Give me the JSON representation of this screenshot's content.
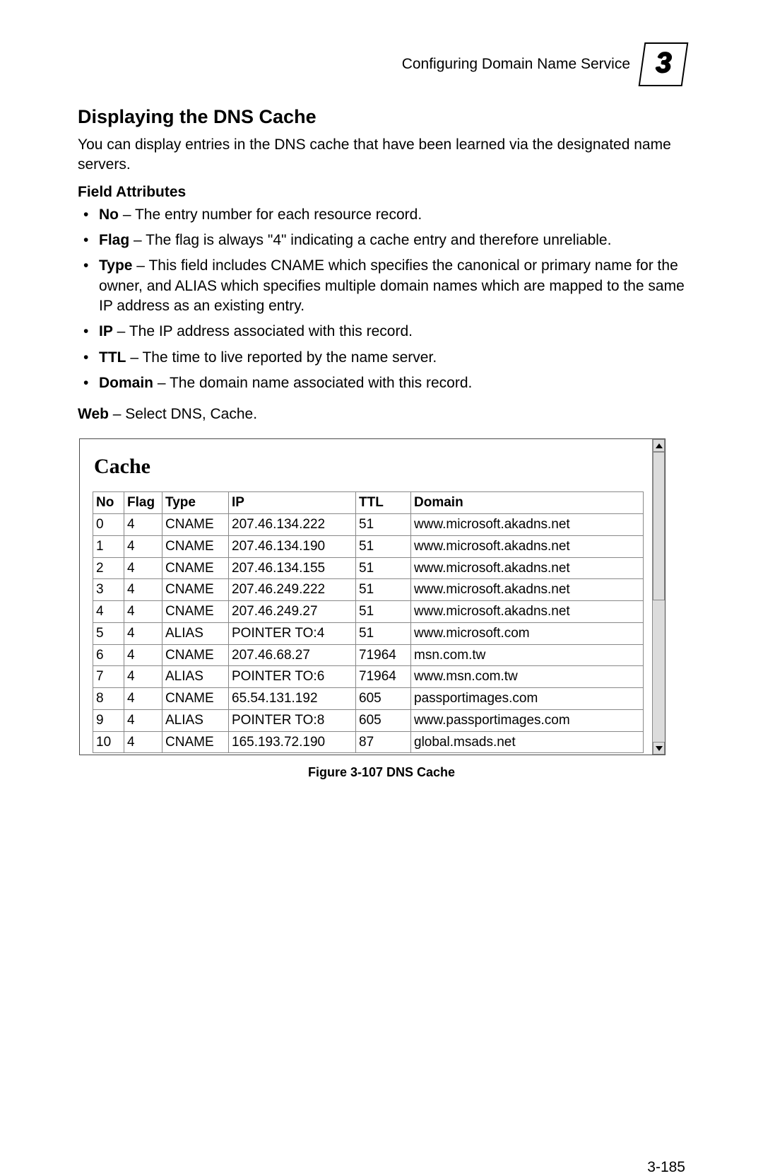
{
  "header": {
    "breadcrumb": "Configuring Domain Name Service",
    "chapter": "3"
  },
  "section": {
    "title": "Displaying the DNS Cache",
    "intro": "You can display entries in the DNS cache that have been learned via the designated name servers.",
    "field_attributes_heading": "Field Attributes",
    "attributes": [
      {
        "term": "No",
        "desc": " – The entry number for each resource record."
      },
      {
        "term": "Flag",
        "desc": " – The flag is always \"4\" indicating a cache entry and therefore unreliable."
      },
      {
        "term": "Type",
        "desc": " – This field includes CNAME which specifies the canonical or primary name for the owner, and ALIAS which specifies multiple domain names which are mapped to the same IP address as an existing entry."
      },
      {
        "term": "IP",
        "desc": " – The IP address associated with this record."
      },
      {
        "term": "TTL",
        "desc": " – The time to live reported by the name server."
      },
      {
        "term": "Domain",
        "desc": " – The domain name associated with this record."
      }
    ],
    "web_label": "Web",
    "web_text": " – Select DNS, Cache."
  },
  "panel": {
    "title": "Cache",
    "columns": [
      "No",
      "Flag",
      "Type",
      "IP",
      "TTL",
      "Domain"
    ],
    "rows": [
      {
        "no": "0",
        "flag": "4",
        "type": "CNAME",
        "ip": "207.46.134.222",
        "ttl": "51",
        "domain": "www.microsoft.akadns.net"
      },
      {
        "no": "1",
        "flag": "4",
        "type": "CNAME",
        "ip": "207.46.134.190",
        "ttl": "51",
        "domain": "www.microsoft.akadns.net"
      },
      {
        "no": "2",
        "flag": "4",
        "type": "CNAME",
        "ip": "207.46.134.155",
        "ttl": "51",
        "domain": "www.microsoft.akadns.net"
      },
      {
        "no": "3",
        "flag": "4",
        "type": "CNAME",
        "ip": "207.46.249.222",
        "ttl": "51",
        "domain": "www.microsoft.akadns.net"
      },
      {
        "no": "4",
        "flag": "4",
        "type": "CNAME",
        "ip": "207.46.249.27",
        "ttl": "51",
        "domain": "www.microsoft.akadns.net"
      },
      {
        "no": "5",
        "flag": "4",
        "type": "ALIAS",
        "ip": "POINTER TO:4",
        "ttl": "51",
        "domain": "www.microsoft.com"
      },
      {
        "no": "6",
        "flag": "4",
        "type": "CNAME",
        "ip": "207.46.68.27",
        "ttl": "71964",
        "domain": "msn.com.tw"
      },
      {
        "no": "7",
        "flag": "4",
        "type": "ALIAS",
        "ip": "POINTER TO:6",
        "ttl": "71964",
        "domain": "www.msn.com.tw"
      },
      {
        "no": "8",
        "flag": "4",
        "type": "CNAME",
        "ip": "65.54.131.192",
        "ttl": "605",
        "domain": "passportimages.com"
      },
      {
        "no": "9",
        "flag": "4",
        "type": "ALIAS",
        "ip": "POINTER TO:8",
        "ttl": "605",
        "domain": "www.passportimages.com"
      },
      {
        "no": "10",
        "flag": "4",
        "type": "CNAME",
        "ip": "165.193.72.190",
        "ttl": "87",
        "domain": "global.msads.net"
      }
    ]
  },
  "figure_caption": "Figure 3-107   DNS Cache",
  "page_number": "3-185"
}
